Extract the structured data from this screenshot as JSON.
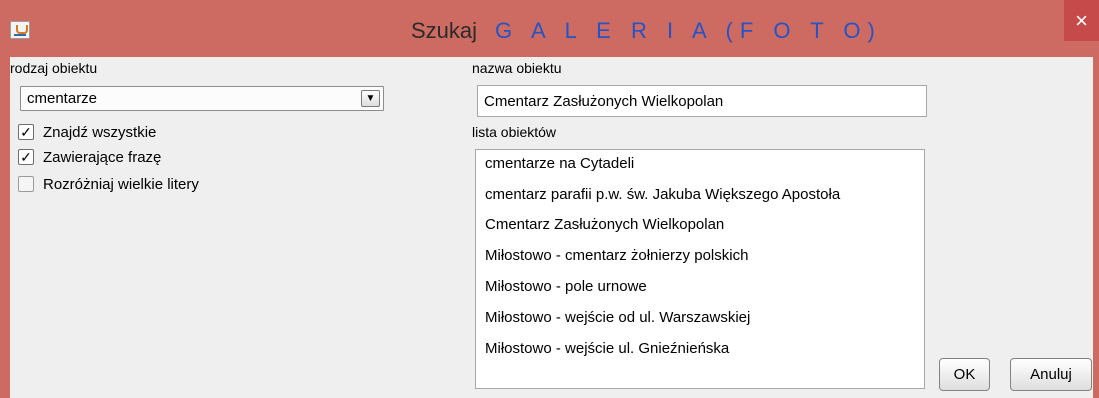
{
  "window": {
    "title_prefix": "Szukaj",
    "title_main": "G A L E R I A (F O T O)",
    "close_symbol": "×"
  },
  "left_panel": {
    "object_type_label": "rodzaj obiektu",
    "object_type_value": "cmentarze",
    "dropdown_arrow": "▼",
    "checkboxes": [
      {
        "label": "Znajdź wszystkie",
        "checked": true,
        "mark": "✓"
      },
      {
        "label": "Zawierające frazę",
        "checked": true,
        "mark": "✓"
      },
      {
        "label": "Rozróżniaj wielkie litery",
        "checked": false,
        "mark": ""
      }
    ]
  },
  "right_panel": {
    "object_name_label": "nazwa obiektu",
    "object_name_value": "Cmentarz Zasłużonych Wielkopolan",
    "object_list_label": "lista obiektów",
    "objects": [
      "cmentarze na Cytadeli",
      "cmentarz parafii p.w. św. Jakuba Większego Apostoła",
      "Cmentarz Zasłużonych Wielkopolan",
      "Miłostowo - cmentarz żołnierzy polskich",
      "Miłostowo - pole urnowe",
      "Miłostowo - wejście od ul. Warszawskiej",
      "Miłostowo - wejście ul. Gnieźnieńska"
    ]
  },
  "buttons": {
    "ok": "OK",
    "cancel": "Anuluj"
  },
  "colors": {
    "frame": "#cd6a61",
    "close": "#c64a49",
    "title_accent": "#2454c5"
  },
  "icons": {
    "app": "java-app-icon",
    "close": "close-icon",
    "dropdown": "chevron-down-icon",
    "checked": "checkmark-icon"
  }
}
